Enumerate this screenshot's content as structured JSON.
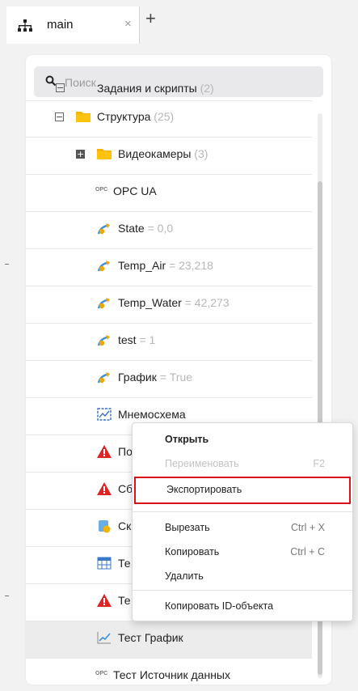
{
  "tab": {
    "title": "main",
    "close": "×",
    "add": "+"
  },
  "search": {
    "placeholder": "Поиск"
  },
  "tree": {
    "partial": {
      "label": "Задания и скрипты",
      "suffix": "(2)"
    },
    "rows": [
      {
        "label": "Структура",
        "suffix": " (25)",
        "icon": "folder-icon"
      },
      {
        "label": "Видеокамеры",
        "suffix": " (3)",
        "icon": "folder-icon"
      },
      {
        "label": "OPC UA",
        "suffix": "",
        "icon": "opc-icon",
        "icon_text": "OPC"
      },
      {
        "label": "State",
        "suffix": " = 0,0",
        "icon": "tag-icon"
      },
      {
        "label": "Temp_Air",
        "suffix": " = 23,218",
        "icon": "tag-icon"
      },
      {
        "label": "Temp_Water",
        "suffix": " = 42,273",
        "icon": "tag-icon"
      },
      {
        "label": "test",
        "suffix": " = 1",
        "icon": "tag-icon"
      },
      {
        "label": "График",
        "suffix": " = True",
        "icon": "tag-icon"
      },
      {
        "label": "Мнемосхема",
        "suffix": "",
        "icon": "mnemonic-icon"
      },
      {
        "label": "По",
        "suffix": "",
        "icon": "warning-icon"
      },
      {
        "label": "Сб",
        "suffix": "",
        "icon": "warning-icon"
      },
      {
        "label": "Ск",
        "suffix": "",
        "icon": "script-icon"
      },
      {
        "label": "Те",
        "suffix": "",
        "icon": "table-icon"
      },
      {
        "label": "Те",
        "suffix": "",
        "icon": "warning-icon"
      },
      {
        "label": "Тест График",
        "suffix": "",
        "icon": "chart-icon"
      },
      {
        "label": "Тест Источник данных",
        "suffix": "",
        "icon": "opc-icon",
        "icon_text": "OPC"
      }
    ]
  },
  "context_menu": {
    "open": "Открыть",
    "rename": "Переименовать",
    "rename_shortcut": "F2",
    "export": "Экспортировать",
    "cut": "Вырезать",
    "cut_shortcut": "Ctrl + X",
    "copy": "Копировать",
    "copy_shortcut": "Ctrl + C",
    "delete": "Удалить",
    "copy_id": "Копировать ID-объекта"
  },
  "colors": {
    "folder": "#f5b400",
    "tag": "#f0a500",
    "warning": "#e02424",
    "highlight": "#e0101b"
  }
}
